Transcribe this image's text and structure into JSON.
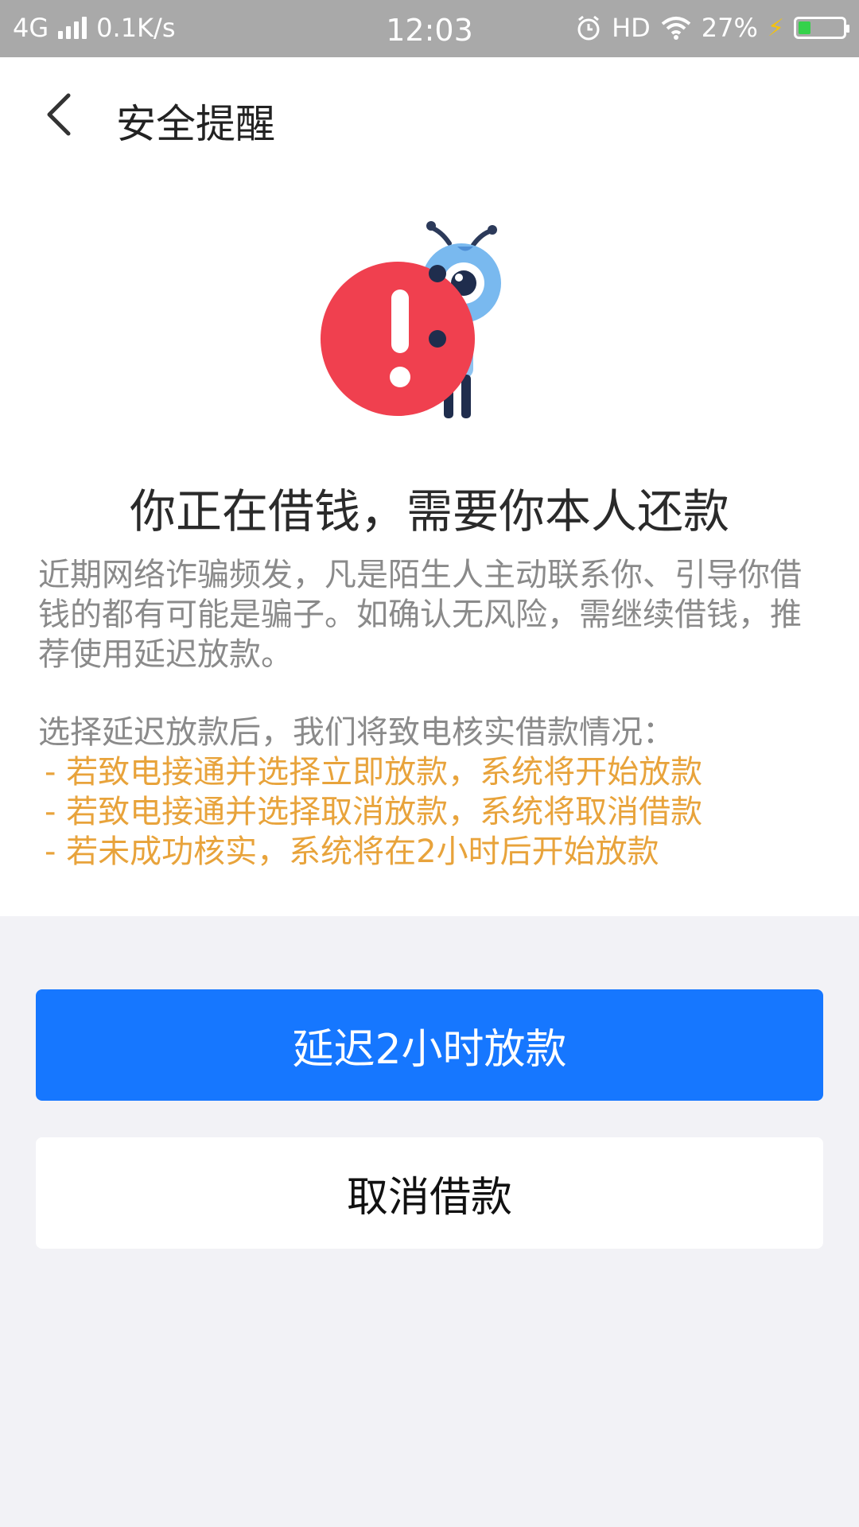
{
  "status_bar": {
    "network": "4G",
    "speed": "0.1K/s",
    "time": "12:03",
    "hd": "HD",
    "battery": "27%",
    "battery_level": 0.27,
    "icons": [
      "signal-icon",
      "alarm-icon",
      "wifi-icon",
      "charging-icon",
      "battery-icon"
    ]
  },
  "nav": {
    "back_icon": "chevron-left-icon",
    "title": "安全提醒"
  },
  "content": {
    "illustration": "warning-mascot-icon",
    "headline": "你正在借钱，需要你本人还款",
    "description": "近期网络诈骗频发，凡是陌生人主动联系你、引导你借钱的都有可能是骗子。如确认无风险，需继续借钱，推荐使用延迟放款。",
    "note_title": "选择延迟放款后，我们将致电核实借款情况：",
    "notes": [
      "- 若致电接通并选择立即放款，系统将开始放款",
      "- 若致电接通并选择取消放款，系统将取消借款",
      "- 若未成功核实，系统将在2小时后开始放款"
    ]
  },
  "actions": {
    "primary_label": "延迟2小时放款",
    "secondary_label": "取消借款"
  },
  "colors": {
    "primary": "#1677ff",
    "warning_red": "#f0404f",
    "note_text": "#e8a33b"
  }
}
